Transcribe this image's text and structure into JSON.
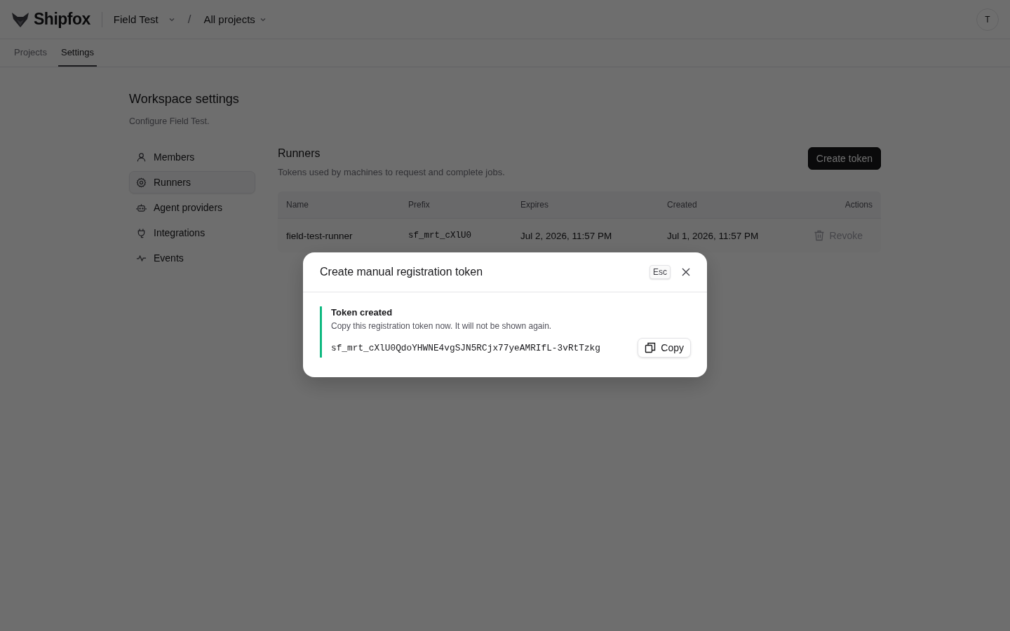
{
  "header": {
    "brand": "Shipfox",
    "workspace": "Field Test",
    "separator": "/",
    "project": "All projects",
    "avatar": "T"
  },
  "tabs": [
    {
      "label": "Projects",
      "selected": false
    },
    {
      "label": "Settings",
      "selected": true
    }
  ],
  "page": {
    "title": "Workspace settings",
    "subtitle": "Configure Field Test."
  },
  "sidebar": {
    "items": [
      {
        "label": "Members",
        "selected": false
      },
      {
        "label": "Runners",
        "selected": true
      },
      {
        "label": "Agent providers",
        "selected": false
      },
      {
        "label": "Integrations",
        "selected": false
      },
      {
        "label": "Events",
        "selected": false
      }
    ]
  },
  "section": {
    "title": "Runners",
    "description": "Tokens used by machines to request and complete jobs.",
    "create_button": "Create token"
  },
  "table": {
    "columns": [
      "Name",
      "Prefix",
      "Expires",
      "Created",
      "Actions"
    ],
    "rows": [
      {
        "name": "field-test-runner",
        "prefix": "sf_mrt_cXlU0",
        "expires": "Jul 2, 2026, 11:57 PM",
        "created": "Jul 1, 2026, 11:57 PM",
        "action": "Revoke"
      }
    ]
  },
  "modal": {
    "title": "Create manual registration token",
    "esc_key": "Esc",
    "notice_title": "Token created",
    "notice_text": "Copy this registration token now. It will not be shown again.",
    "token": "sf_mrt_cXlU0QdoYHWNE4vgSJN5RCjx77yeAMRIfL-3vRtTzkg",
    "copy_button": "Copy"
  }
}
